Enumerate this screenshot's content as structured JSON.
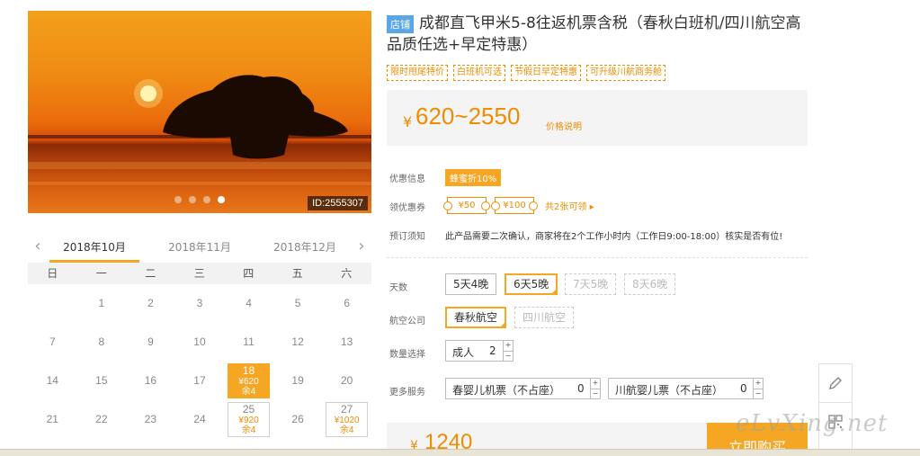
{
  "photo": {
    "id_label": "ID:2555307",
    "slide_count": 4,
    "active_slide": 4
  },
  "calendar": {
    "months": [
      "2018年10月",
      "2018年11月",
      "2018年12月"
    ],
    "active_month": 0,
    "weekdays": [
      "日",
      "一",
      "二",
      "三",
      "四",
      "五",
      "六"
    ],
    "prev_icon": "chevron-left-icon",
    "next_icon": "chevron-right-icon",
    "days": [
      {
        "day": ""
      },
      {
        "day": "1"
      },
      {
        "day": "2"
      },
      {
        "day": "3"
      },
      {
        "day": "4"
      },
      {
        "day": "5"
      },
      {
        "day": "6"
      },
      {
        "day": "7"
      },
      {
        "day": "8"
      },
      {
        "day": "9"
      },
      {
        "day": "10"
      },
      {
        "day": "11"
      },
      {
        "day": "12"
      },
      {
        "day": "13"
      },
      {
        "day": "14"
      },
      {
        "day": "15"
      },
      {
        "day": "16"
      },
      {
        "day": "17"
      },
      {
        "day": "18",
        "price": "¥620",
        "stock": "余4",
        "state": "selected"
      },
      {
        "day": "19"
      },
      {
        "day": "20"
      },
      {
        "day": "21"
      },
      {
        "day": "22"
      },
      {
        "day": "23"
      },
      {
        "day": "24"
      },
      {
        "day": "25",
        "price": "¥920",
        "stock": "余4",
        "state": "available"
      },
      {
        "day": "26"
      },
      {
        "day": "27",
        "price": "¥1020",
        "stock": "余4",
        "state": "available"
      }
    ]
  },
  "product": {
    "shop_tag": "店铺",
    "title": "成都直飞甲米5-8往返机票含税（春秋白班机/四川航空高品质任选+早定特惠）",
    "badges": [
      "限时甩尾特价",
      "白班机可选",
      "节假日早定特惠",
      "可升级川航商务舱"
    ],
    "currency": "¥",
    "price_range": "620~2550",
    "price_explain": "价格说明"
  },
  "info": {
    "discount_label": "优惠信息",
    "discount_value": "蜂蜜折10%",
    "coupon_label": "领优惠券",
    "coupons": [
      "¥50",
      "¥100"
    ],
    "coupon_link": "共2张可领",
    "notice_label": "预订须知",
    "notice_text": "此产品需要二次确认，商家将在2个工作小时内（工作日9:00-18:00）核实是否有位!"
  },
  "options": {
    "days_label": "天数",
    "days": [
      {
        "label": "5天4晚",
        "state": "normal"
      },
      {
        "label": "6天5晚",
        "state": "selected"
      },
      {
        "label": "7天5晚",
        "state": "disabled"
      },
      {
        "label": "8天6晚",
        "state": "disabled"
      }
    ],
    "airline_label": "航空公司",
    "airlines": [
      {
        "label": "春秋航空",
        "state": "selected"
      },
      {
        "label": "四川航空",
        "state": "disabled"
      }
    ],
    "qty_label": "数量选择",
    "qty": {
      "label": "成人",
      "value": "2"
    },
    "services_label": "更多服务",
    "services": [
      {
        "label": "春婴儿机票（不占座）",
        "value": "0"
      },
      {
        "label": "川航婴儿票（不占座）",
        "value": "0"
      }
    ]
  },
  "footer": {
    "currency": "¥",
    "total": "1240",
    "buy_label": "立即购买"
  },
  "side_tools": [
    "edit-icon",
    "qrcode-icon"
  ],
  "watermark": "eLvXing.net",
  "colors": {
    "accent": "#f5a623",
    "price": "#f08c00",
    "shop_tag": "#5aa6e6"
  }
}
